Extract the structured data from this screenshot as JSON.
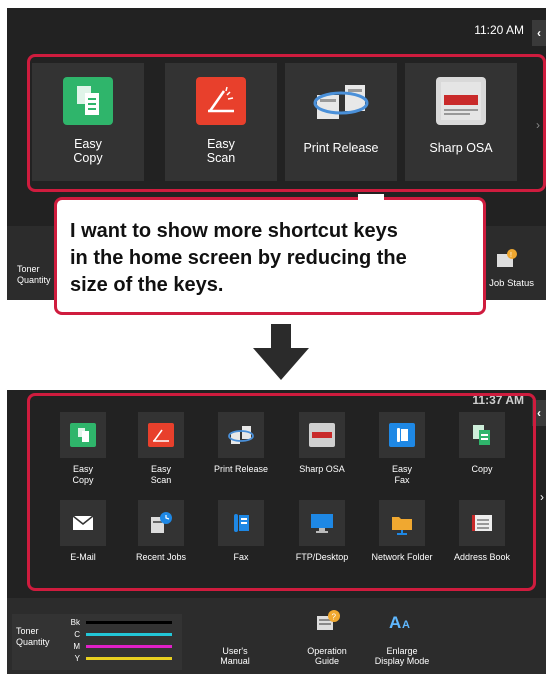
{
  "top_panel": {
    "time": "11:20 AM",
    "keys": [
      {
        "label": "Easy\nCopy",
        "icon": "easy-copy-icon",
        "color": "#2fb56b"
      },
      {
        "label": "Easy\nScan",
        "icon": "easy-scan-icon",
        "color": "#e8402c"
      },
      {
        "label": "Print Release",
        "icon": "print-release-icon",
        "color": "#4a90d9"
      },
      {
        "label": "Sharp OSA",
        "icon": "sharp-osa-icon",
        "color": "#d9d9d9"
      }
    ],
    "bottom_bar": {
      "toner_label": "Toner\nQuantity",
      "job_status_label": "Job Status"
    }
  },
  "callout": {
    "text": "I want to show more shortcut keys\nin the home screen by reducing the\nsize of the keys."
  },
  "bottom_panel": {
    "time": "11:37 AM",
    "keys": [
      {
        "label": "Easy\nCopy",
        "icon": "easy-copy-icon",
        "color": "#2fb56b"
      },
      {
        "label": "Easy\nScan",
        "icon": "easy-scan-icon",
        "color": "#e8402c"
      },
      {
        "label": "Print Release",
        "icon": "print-release-icon",
        "color": "#4a90d9"
      },
      {
        "label": "Sharp OSA",
        "icon": "sharp-osa-icon",
        "color": "#cfcfcf"
      },
      {
        "label": "Easy\nFax",
        "icon": "easy-fax-icon",
        "color": "#1e88e5"
      },
      {
        "label": "Copy",
        "icon": "copy-icon",
        "color": "#2fb56b"
      },
      {
        "label": "E-Mail",
        "icon": "email-icon",
        "color": "#ffffff"
      },
      {
        "label": "Recent Jobs",
        "icon": "recent-jobs-icon",
        "color": "#ffffff"
      },
      {
        "label": "Fax",
        "icon": "fax-icon",
        "color": "#1e88e5"
      },
      {
        "label": "FTP/Desktop",
        "icon": "ftp-desktop-icon",
        "color": "#1e88e5"
      },
      {
        "label": "Network Folder",
        "icon": "network-folder-icon",
        "color": "#f0a830"
      },
      {
        "label": "Address Book",
        "icon": "address-book-icon",
        "color": "#ffffff"
      }
    ],
    "bottom_bar": {
      "toner_label": "Toner\nQuantity",
      "toner_channels": [
        {
          "ch": "Bk",
          "color": "#000000"
        },
        {
          "ch": "C",
          "color": "#22c7d8"
        },
        {
          "ch": "M",
          "color": "#e020c8"
        },
        {
          "ch": "Y",
          "color": "#e8d020"
        }
      ],
      "users_manual_label": "User's\nManual",
      "operation_guide_label": "Operation\nGuide",
      "enlarge_display_label": "Enlarge\nDisplay Mode"
    }
  },
  "colors": {
    "highlight": "#cf1c3e",
    "panel_bg": "#222222",
    "key_bg": "#333333"
  }
}
